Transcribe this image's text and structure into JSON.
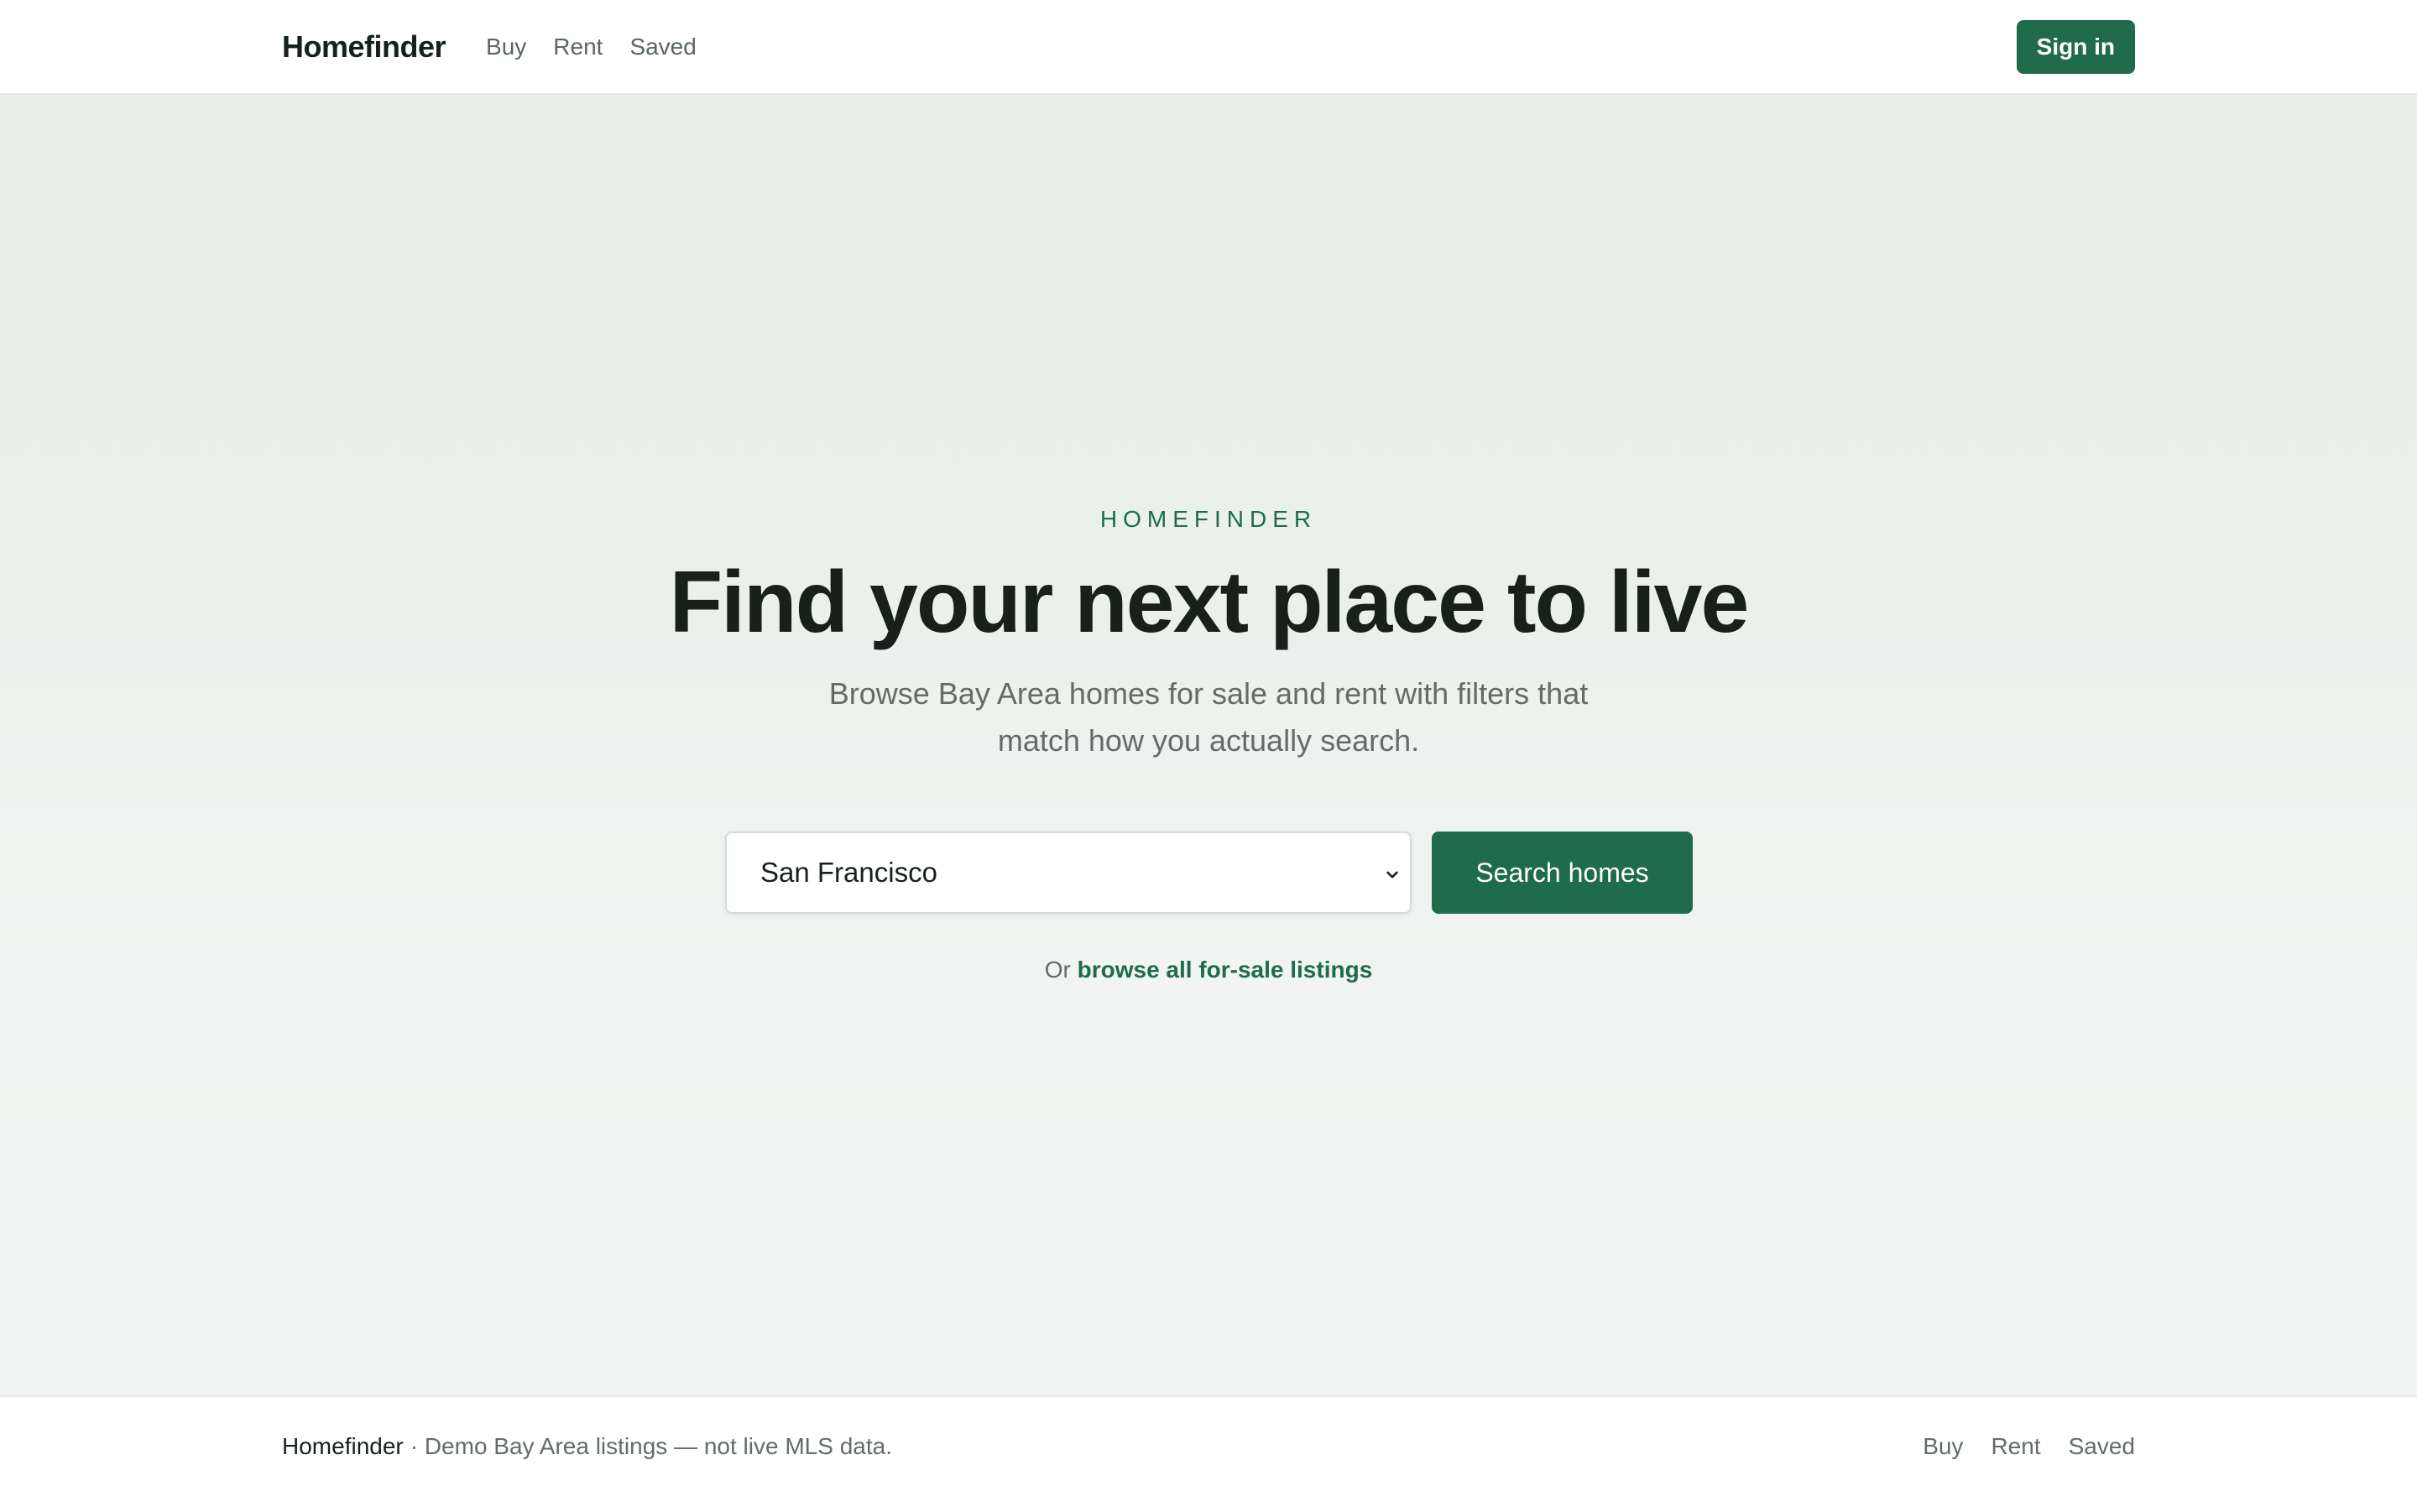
{
  "header": {
    "brand": "Homefinder",
    "nav": [
      "Buy",
      "Rent",
      "Saved"
    ],
    "sign_in_label": "Sign in"
  },
  "hero": {
    "eyebrow": "HOMEFINDER",
    "title": "Find your next place to live",
    "subtitle": "Browse Bay Area homes for sale and rent with filters that match how you actually search.",
    "location_select": {
      "selected": "San Francisco"
    },
    "search_button_label": "Search homes",
    "browse_prefix": "Or",
    "browse_link_label": "browse all for-sale listings"
  },
  "footer": {
    "brand": "Homefinder",
    "note": "· Demo Bay Area listings — not live MLS data.",
    "nav": [
      "Buy",
      "Rent",
      "Saved"
    ]
  },
  "colors": {
    "accent": "#1f6b4b",
    "text": "#17211c",
    "muted": "#626d68"
  },
  "icons": {
    "select_indicator": "chevron-down-icon"
  }
}
